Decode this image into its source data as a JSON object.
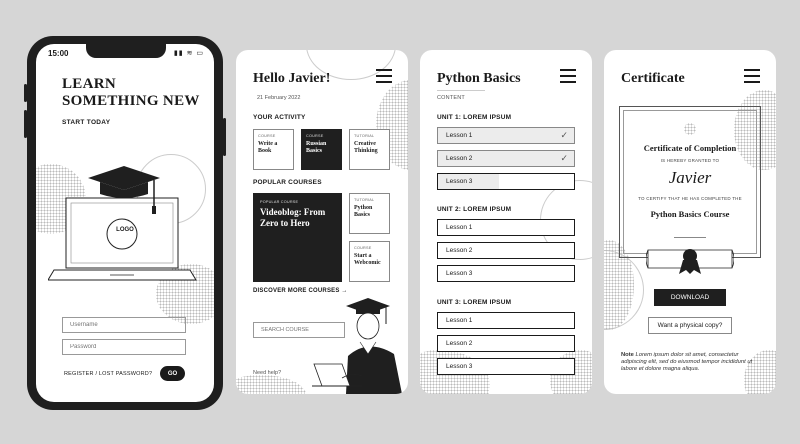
{
  "phone": {
    "time": "15:00",
    "status_icons": "▮▮ ≋ ▭",
    "title_line1": "LEARN",
    "title_line2": "SOMETHING NEW",
    "subtitle": "START TODAY",
    "logo_text": "LOGO",
    "username_placeholder": "Username",
    "password_placeholder": "Password",
    "links": "REGISTER / LOST PASSWORD?",
    "go_label": "GO"
  },
  "home": {
    "greeting": "Hello Javier!",
    "date": "21 February 2022",
    "activity_heading": "YOUR ACTIVITY",
    "activity": [
      {
        "tag": "COURSE",
        "name": "Write a Book"
      },
      {
        "tag": "COURSE",
        "name": "Russian Basics"
      },
      {
        "tag": "TUTORIAL",
        "name": "Creative Thinking"
      }
    ],
    "popular_heading": "POPULAR COURSES",
    "popular_main": {
      "tag": "POPULAR COURSE",
      "name": "Videoblog: From Zero to Hero"
    },
    "popular_side": [
      {
        "tag": "TUTORIAL",
        "name": "Python Basics"
      },
      {
        "tag": "COURSE",
        "name": "Start a Webcomic"
      }
    ],
    "discover": "DISCOVER MORE COURSES →",
    "search_placeholder": "SEARCH COURSE",
    "help": "Need help?"
  },
  "course": {
    "title": "Python Basics",
    "content_label": "CONTENT",
    "units": [
      {
        "title": "UNIT 1: LOREM IPSUM",
        "lessons": [
          {
            "label": "Lesson 1",
            "status": "done"
          },
          {
            "label": "Lesson 2",
            "status": "done"
          },
          {
            "label": "Lesson 3",
            "status": "partial",
            "progress": 0.45
          }
        ]
      },
      {
        "title": "UNIT 2: LOREM IPSUM",
        "lessons": [
          {
            "label": "Lesson 1",
            "status": "todo"
          },
          {
            "label": "Lesson 2",
            "status": "todo"
          },
          {
            "label": "Lesson 3",
            "status": "todo"
          }
        ]
      },
      {
        "title": "UNIT 3: LOREM IPSUM",
        "lessons": [
          {
            "label": "Lesson 1",
            "status": "todo"
          },
          {
            "label": "Lesson 2",
            "status": "todo"
          },
          {
            "label": "Lesson 3",
            "status": "todo"
          }
        ]
      }
    ]
  },
  "certificate": {
    "title": "Certificate",
    "heading": "Certificate of Completion",
    "granted": "IS HEREBY GRANTED TO",
    "name": "Javier",
    "certify": "TO CERTIFY THAT HE HAS COMPLETED THE",
    "course": "Python Basics Course",
    "download": "DOWNLOAD",
    "physical": "Want a physical copy?",
    "note_label": "Note",
    "note_text": "Lorem ipsum dolor sit amet, consectetur adipiscing elit, sed do eiusmod tempor incididunt ut labore et dolore magna aliqua."
  }
}
